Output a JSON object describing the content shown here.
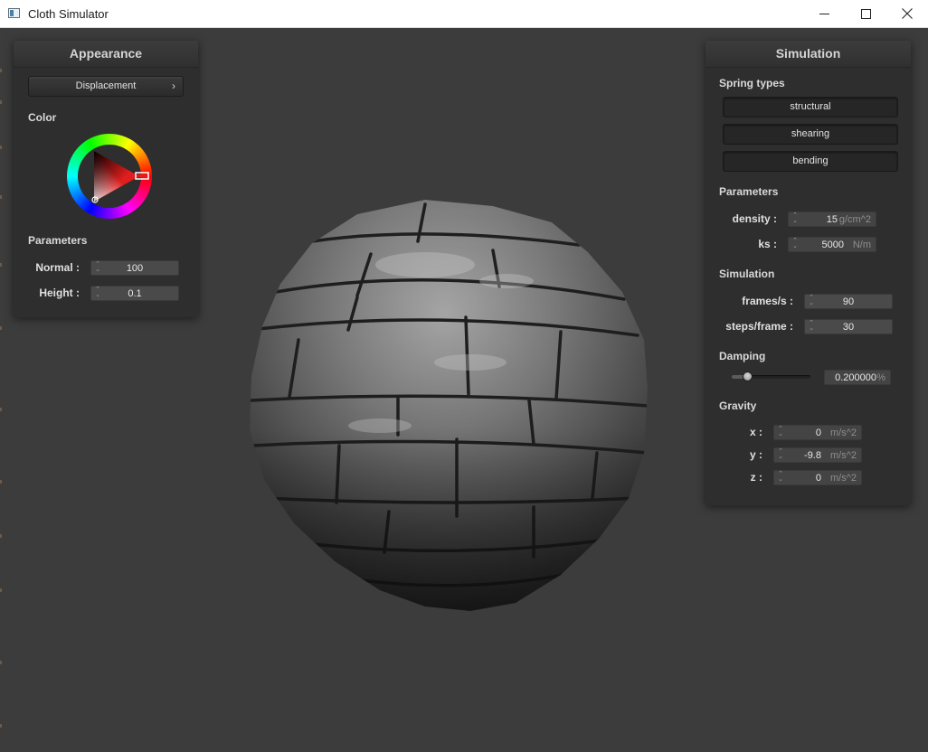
{
  "window": {
    "title": "Cloth Simulator"
  },
  "appearance": {
    "title": "Appearance",
    "shader_popup": "Displacement",
    "color_label": "Color",
    "params_label": "Parameters",
    "normal_label": "Normal :",
    "normal_value": "100",
    "height_label": "Height :",
    "height_value": "0.1"
  },
  "simulation": {
    "title": "Simulation",
    "spring_types_label": "Spring types",
    "spring_buttons": [
      "structural",
      "shearing",
      "bending"
    ],
    "params_label": "Parameters",
    "density_label": "density :",
    "density_value": "15",
    "density_unit": "g/cm^2",
    "ks_label": "ks :",
    "ks_value": "5000",
    "ks_unit": "N/m",
    "sim_label": "Simulation",
    "fps_label": "frames/s :",
    "fps_value": "90",
    "steps_label": "steps/frame :",
    "steps_value": "30",
    "damping_label": "Damping",
    "damping_value": "0.200000",
    "damping_unit": "%",
    "damping_fraction": 0.2,
    "gravity_label": "Gravity",
    "gx_label": "x :",
    "gx_value": "0",
    "gy_label": "y :",
    "gy_value": "-9.8",
    "gz_label": "z :",
    "gz_value": "0",
    "g_unit": "m/s^2"
  },
  "colors": {
    "background": "#3c3c3c",
    "panel": "#2e2e2e",
    "selected_color": "#e11d1d"
  }
}
